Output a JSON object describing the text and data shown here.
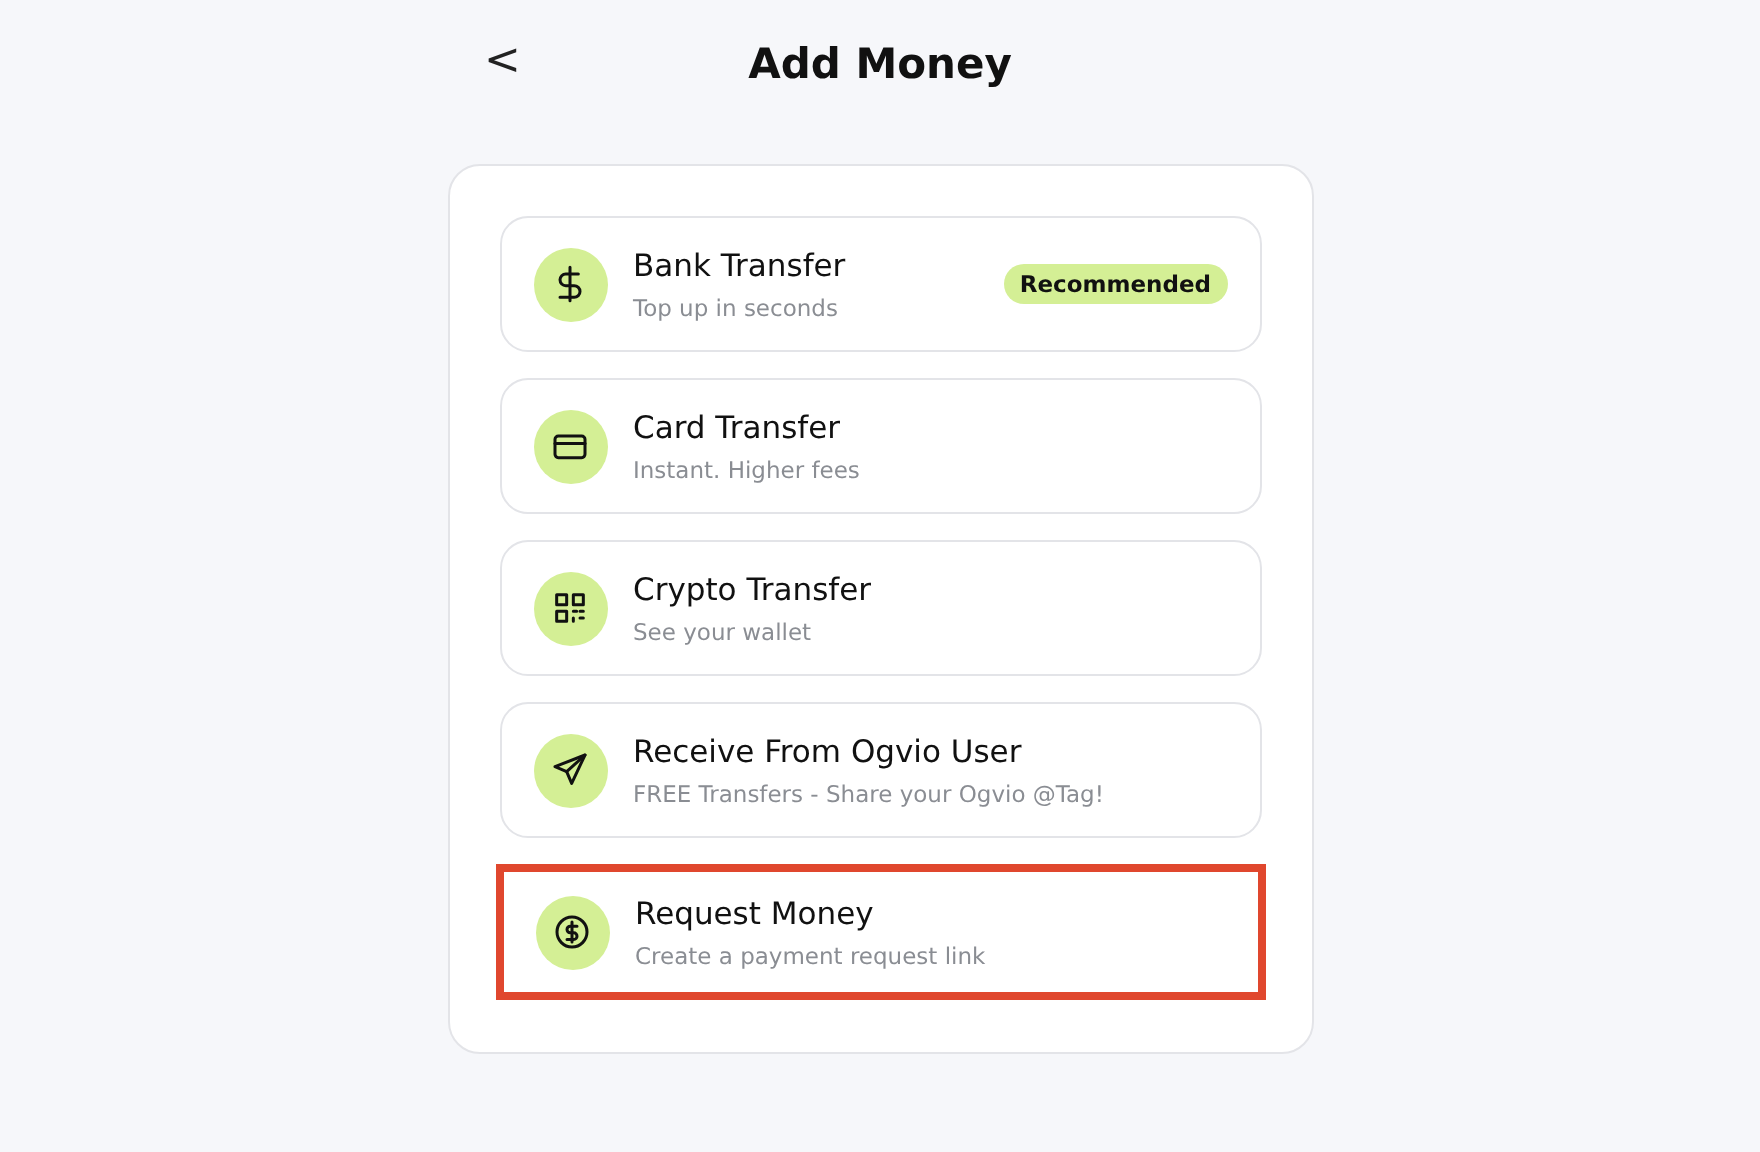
{
  "header": {
    "back": "<",
    "title": "Add Money"
  },
  "options": [
    {
      "kind": "dollar",
      "title": "Bank Transfer",
      "subtitle": "Top up in seconds",
      "badge": "Recommended",
      "highlighted": false
    },
    {
      "kind": "card",
      "title": "Card Transfer",
      "subtitle": "Instant. Higher fees",
      "highlighted": false
    },
    {
      "kind": "qr",
      "title": "Crypto Transfer",
      "subtitle": "See your wallet",
      "highlighted": false
    },
    {
      "kind": "send",
      "title": "Receive From Ogvio User",
      "subtitle": "FREE Transfers - Share your Ogvio @Tag!",
      "highlighted": false
    },
    {
      "kind": "dollarcircle",
      "title": "Request Money",
      "subtitle": "Create a payment request link",
      "highlighted": true
    }
  ]
}
